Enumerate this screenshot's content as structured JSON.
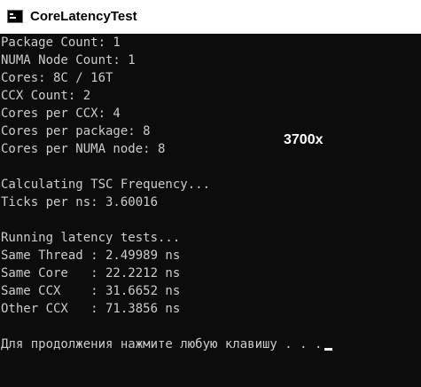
{
  "window": {
    "title": "CoreLatencyTest",
    "app_icon": "console-icon"
  },
  "console": {
    "lines": [
      "Package Count: 1",
      "NUMA Node Count: 1",
      "Cores: 8C / 16T",
      "CCX Count: 2",
      "Cores per CCX: 4",
      "Cores per package: 8",
      "Cores per NUMA node: 8",
      "",
      "Calculating TSC Frequency...",
      "Ticks per ns: 3.60016",
      "",
      "Running latency tests...",
      "Same Thread : 2.49989 ns",
      "Same Core   : 22.2212 ns",
      "Same CCX    : 31.6652 ns",
      "Other CCX   : 71.3856 ns",
      "",
      "Для продолжения нажмите любую клавишу . . ."
    ],
    "text_color": "#cccccc",
    "background": "#0c0c0c"
  },
  "overlay": {
    "label": "3700x"
  }
}
